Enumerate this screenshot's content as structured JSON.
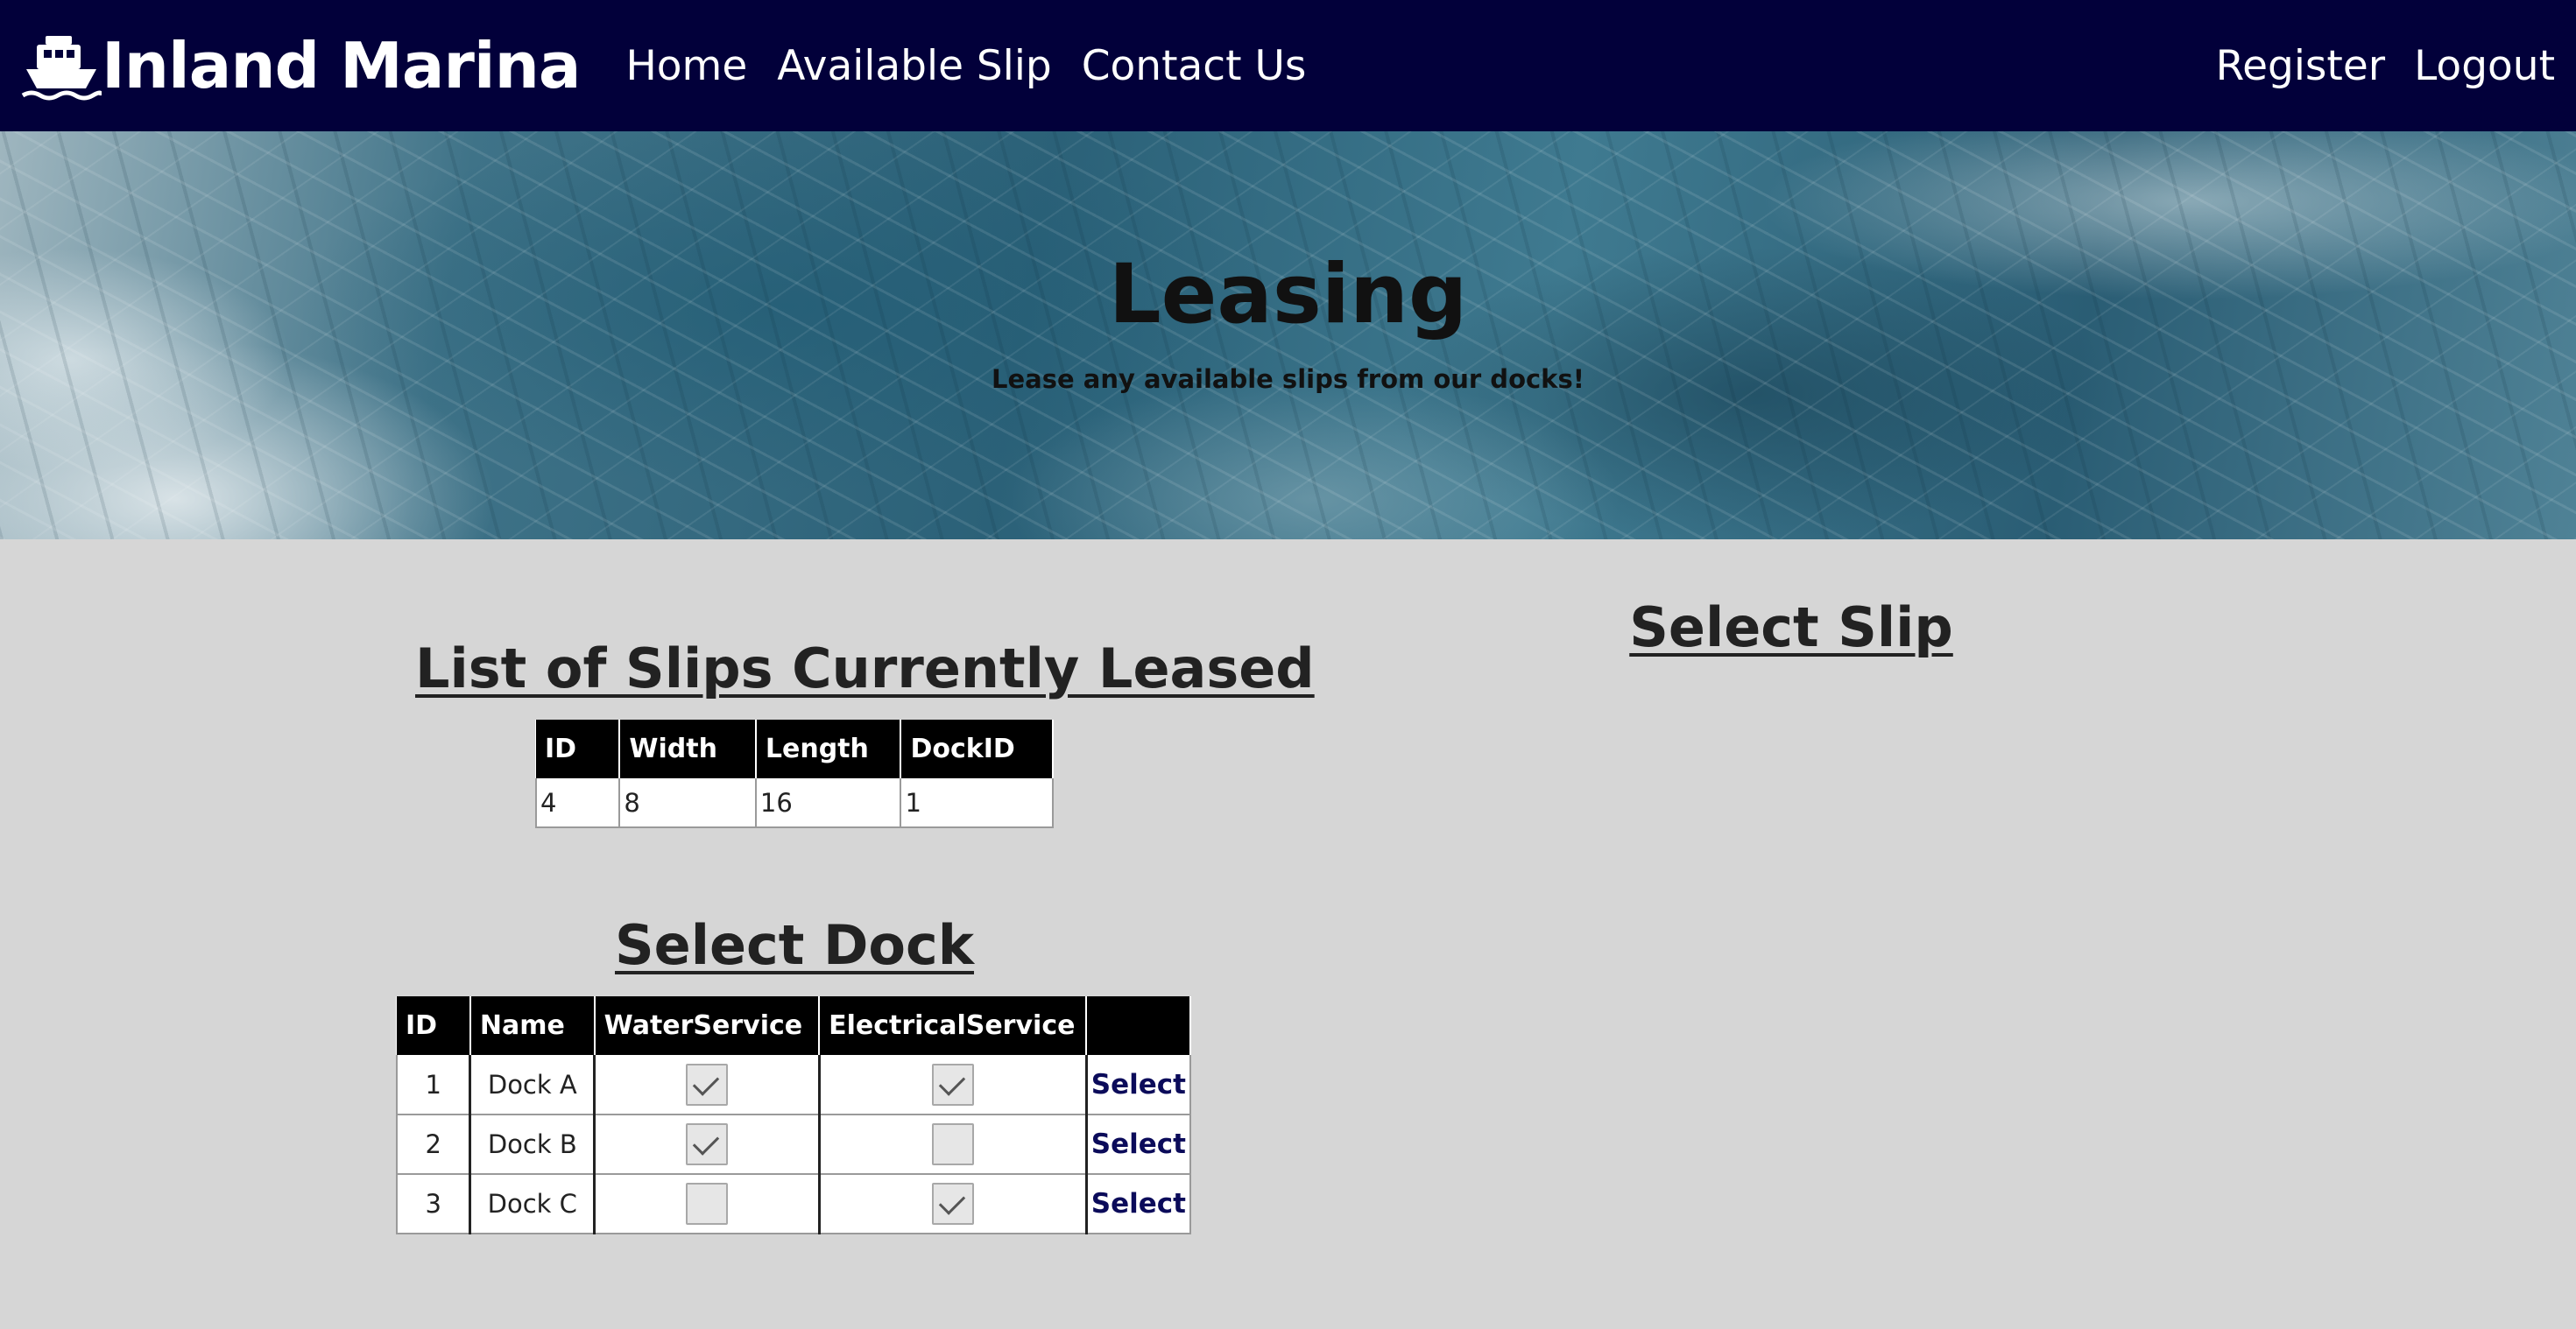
{
  "navbar": {
    "brand": "Inland Marina",
    "brand_icon": "ship-icon",
    "links": [
      "Home",
      "Available Slip",
      "Contact Us"
    ],
    "right_links": [
      "Register",
      "Logout"
    ],
    "background_color": "#02003a"
  },
  "hero": {
    "title": "Leasing",
    "subtitle": "Lease any available slips from our docks!"
  },
  "leased": {
    "heading": "List of Slips Currently Leased",
    "columns": [
      "ID",
      "Width",
      "Length",
      "DockID"
    ],
    "rows": [
      [
        "4",
        "8",
        "16",
        "1"
      ]
    ]
  },
  "select_slip": {
    "heading": "Select Slip"
  },
  "docks": {
    "heading": "Select Dock",
    "columns": [
      "ID",
      "Name",
      "WaterService",
      "ElectricalService",
      ""
    ],
    "rows": [
      {
        "id": "1",
        "name": "Dock A",
        "water": true,
        "electrical": true,
        "action": "Select"
      },
      {
        "id": "2",
        "name": "Dock B",
        "water": true,
        "electrical": false,
        "action": "Select"
      },
      {
        "id": "3",
        "name": "Dock C",
        "water": false,
        "electrical": true,
        "action": "Select"
      }
    ]
  }
}
